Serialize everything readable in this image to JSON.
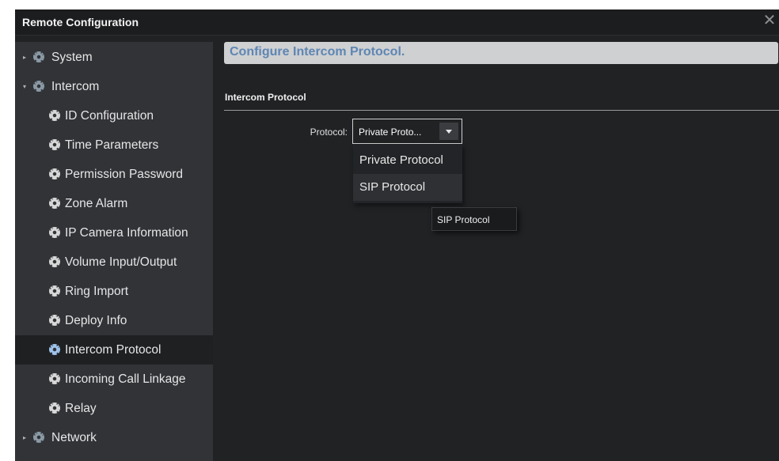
{
  "window": {
    "title": "Remote Configuration",
    "close_icon": "close-icon"
  },
  "sidebar": {
    "items": [
      {
        "label": "System",
        "level": "top",
        "arrow": "▸",
        "active": false
      },
      {
        "label": "Intercom",
        "level": "top",
        "arrow": "▾",
        "active": false
      },
      {
        "label": "ID Configuration",
        "level": "sub",
        "active": false
      },
      {
        "label": "Time Parameters",
        "level": "sub",
        "active": false
      },
      {
        "label": "Permission Password",
        "level": "sub",
        "active": false
      },
      {
        "label": "Zone Alarm",
        "level": "sub",
        "active": false
      },
      {
        "label": "IP Camera Information",
        "level": "sub",
        "active": false
      },
      {
        "label": "Volume Input/Output",
        "level": "sub",
        "active": false
      },
      {
        "label": "Ring Import",
        "level": "sub",
        "active": false
      },
      {
        "label": "Deploy Info",
        "level": "sub",
        "active": false
      },
      {
        "label": "Intercom Protocol",
        "level": "sub",
        "active": true
      },
      {
        "label": "Incoming Call Linkage",
        "level": "sub",
        "active": false
      },
      {
        "label": "Relay",
        "level": "sub",
        "active": false
      },
      {
        "label": "Network",
        "level": "top",
        "arrow": "▸",
        "active": false
      }
    ]
  },
  "main": {
    "header": "Configure Intercom Protocol.",
    "section_title": "Intercom Protocol",
    "protocol_label": "Protocol:",
    "protocol_value": "Private Proto...",
    "options": [
      "Private Protocol",
      "SIP Protocol"
    ],
    "hovered_option": "SIP Protocol",
    "tooltip": "SIP Protocol"
  },
  "colors": {
    "sidebar_bg": "#313337",
    "main_bg": "#202224",
    "header_text": "#5e86b4",
    "gear_top": "#8a9aa6",
    "gear_sub": "#d8d8d8",
    "gear_active": "#9fc4ec"
  }
}
